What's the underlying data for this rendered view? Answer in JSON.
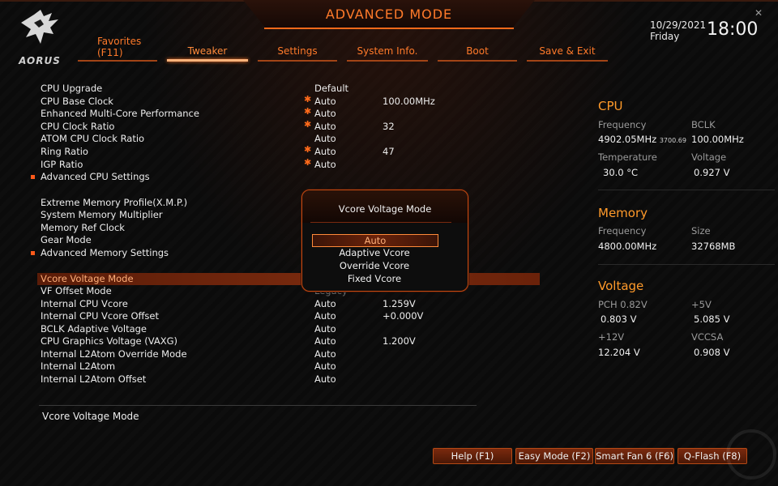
{
  "header": {
    "title": "ADVANCED MODE",
    "logo_text": "AORUS",
    "date": "10/29/2021",
    "day": "Friday",
    "time": "18:00"
  },
  "tabs": [
    {
      "label": "Favorites",
      "sublabel": "(F11)",
      "active": false
    },
    {
      "label": "Tweaker",
      "active": true
    },
    {
      "label": "Settings",
      "active": false
    },
    {
      "label": "System Info.",
      "active": false
    },
    {
      "label": "Boot",
      "active": false
    },
    {
      "label": "Save & Exit",
      "active": false
    }
  ],
  "settings": [
    {
      "name": "CPU Upgrade",
      "value": "Default",
      "value2": "",
      "star": false,
      "bullet": false
    },
    {
      "name": "CPU Base Clock",
      "value": "Auto",
      "value2": "100.00MHz",
      "star": true,
      "bullet": false
    },
    {
      "name": "Enhanced Multi-Core Performance",
      "value": "Auto",
      "value2": "",
      "star": true,
      "bullet": false
    },
    {
      "name": "CPU Clock Ratio",
      "value": "Auto",
      "value2": "32",
      "star": true,
      "bullet": false
    },
    {
      "name": "ATOM CPU Clock Ratio",
      "value": "Auto",
      "value2": "",
      "star": false,
      "bullet": false
    },
    {
      "name": "Ring Ratio",
      "value": "Auto",
      "value2": "47",
      "star": true,
      "bullet": false
    },
    {
      "name": "IGP Ratio",
      "value": "Auto",
      "value2": "",
      "star": true,
      "bullet": false
    },
    {
      "name": "Advanced CPU Settings",
      "value": "",
      "value2": "",
      "star": false,
      "bullet": true
    },
    {
      "name": "Extreme Memory Profile(X.M.P.)",
      "value": "",
      "value2": "",
      "star": false,
      "bullet": false
    },
    {
      "name": "System Memory Multiplier",
      "value": "",
      "value2": "",
      "star": false,
      "bullet": false
    },
    {
      "name": "Memory Ref Clock",
      "value": "",
      "value2": "",
      "star": false,
      "bullet": false
    },
    {
      "name": "Gear Mode",
      "value": "",
      "value2": "",
      "star": false,
      "bullet": false
    },
    {
      "name": "Advanced Memory Settings",
      "value": "",
      "value2": "",
      "star": false,
      "bullet": true
    },
    {
      "name": "Vcore Voltage Mode",
      "value": "",
      "value2": "",
      "star": false,
      "bullet": false,
      "selected": true
    },
    {
      "name": "VF Offset Mode",
      "value": "Legacy",
      "value2": "",
      "star": false,
      "bullet": false,
      "dim": true
    },
    {
      "name": "Internal CPU Vcore",
      "value": "Auto",
      "value2": "1.259V",
      "star": false,
      "bullet": false
    },
    {
      "name": "Internal CPU Vcore Offset",
      "value": "Auto",
      "value2": "+0.000V",
      "star": false,
      "bullet": false
    },
    {
      "name": "BCLK Adaptive Voltage",
      "value": "Auto",
      "value2": "",
      "star": false,
      "bullet": false
    },
    {
      "name": "CPU Graphics Voltage (VAXG)",
      "value": "Auto",
      "value2": "1.200V",
      "star": false,
      "bullet": false
    },
    {
      "name": "Internal L2Atom Override Mode",
      "value": "Auto",
      "value2": "",
      "star": false,
      "bullet": false
    },
    {
      "name": "Internal L2Atom",
      "value": "Auto",
      "value2": "",
      "star": false,
      "bullet": false
    },
    {
      "name": "Internal L2Atom Offset",
      "value": "Auto",
      "value2": "",
      "star": false,
      "bullet": false
    }
  ],
  "popup": {
    "title": "Vcore Voltage Mode",
    "options": [
      "Auto",
      "Adaptive Vcore",
      "Override Vcore",
      "Fixed Vcore"
    ],
    "selected_index": 0
  },
  "monitor": {
    "cpu": {
      "heading": "CPU",
      "freq_label": "Frequency",
      "freq_value": "4902.05MHz",
      "freq_sub": "3700.69",
      "bclk_label": "BCLK",
      "bclk_value": "100.00MHz",
      "temp_label": "Temperature",
      "temp_value": "30.0 °C",
      "volt_label": "Voltage",
      "volt_value": "0.927 V"
    },
    "memory": {
      "heading": "Memory",
      "freq_label": "Frequency",
      "freq_value": "4800.00MHz",
      "size_label": "Size",
      "size_value": "32768MB"
    },
    "voltage": {
      "heading": "Voltage",
      "pch_label": "PCH 0.82V",
      "pch_value": "0.803 V",
      "v5_label": "+5V",
      "v5_value": "5.085 V",
      "v12_label": "+12V",
      "v12_value": "12.204 V",
      "vccsa_label": "VCCSA",
      "vccsa_value": "0.908 V"
    }
  },
  "help_text": "Vcore Voltage Mode",
  "footer_buttons": [
    "Help (F1)",
    "Easy Mode (F2)",
    "Smart Fan 6 (F6)",
    "Q-Flash (F8)"
  ],
  "colors": {
    "accent": "#ff7a2a",
    "heading": "#ff9a2a",
    "selection": "#7a2a0e"
  }
}
